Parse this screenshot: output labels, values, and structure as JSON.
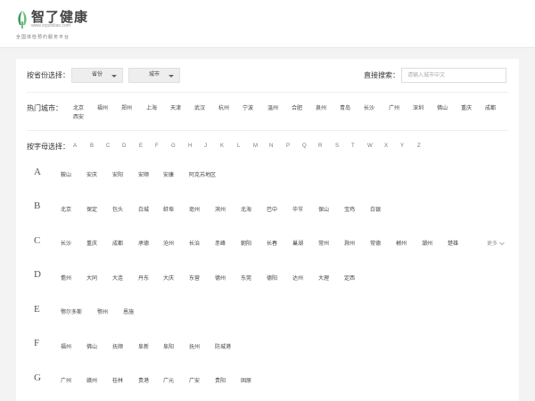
{
  "header": {
    "logo_name": "智了健康",
    "logo_url": "www.xrpzhiliao.com",
    "slogan": "全国体检预约服务平台"
  },
  "filters": {
    "province_label": "按省份选择：",
    "province_value": "省份",
    "city_value": "城市",
    "search_label": "直接搜索：",
    "search_placeholder": "请输入城市中文"
  },
  "hot": {
    "label": "热门城市：",
    "cities": [
      "北京",
      "福州",
      "郑州",
      "上海",
      "天津",
      "武汉",
      "杭州",
      "宁波",
      "温州",
      "合肥",
      "泉州",
      "青岛",
      "长沙",
      "广州",
      "深圳",
      "佛山",
      "重庆",
      "成都",
      "西安"
    ]
  },
  "letters": {
    "label": "按字母选择：",
    "items": [
      "A",
      "B",
      "C",
      "D",
      "E",
      "F",
      "G",
      "H",
      "J",
      "K",
      "L",
      "M",
      "N",
      "P",
      "Q",
      "R",
      "S",
      "T",
      "W",
      "X",
      "Y",
      "Z"
    ]
  },
  "groups": [
    {
      "letter": "A",
      "cities": [
        "鞍山",
        "安庆",
        "安阳",
        "安顺",
        "安康",
        "阿克苏地区"
      ]
    },
    {
      "letter": "B",
      "cities": [
        "北京",
        "保定",
        "包头",
        "白城",
        "蚌埠",
        "亳州",
        "滨州",
        "北海",
        "巴中",
        "毕节",
        "保山",
        "宝鸡",
        "白银"
      ]
    },
    {
      "letter": "C",
      "cities": [
        "长沙",
        "重庆",
        "成都",
        "承德",
        "沧州",
        "长治",
        "赤峰",
        "朝阳",
        "长春",
        "巢湖",
        "常州",
        "滁州",
        "常德",
        "郴州",
        "潮州",
        "楚雄"
      ],
      "more": "更多"
    },
    {
      "letter": "D",
      "cities": [
        "儋州",
        "大同",
        "大连",
        "丹东",
        "大庆",
        "东营",
        "德州",
        "东莞",
        "德阳",
        "达州",
        "大理",
        "定西"
      ]
    },
    {
      "letter": "E",
      "cities": [
        "鄂尔多斯",
        "鄂州",
        "恩施"
      ]
    },
    {
      "letter": "F",
      "cities": [
        "福州",
        "佛山",
        "抚顺",
        "阜新",
        "阜阳",
        "抚州",
        "防城港"
      ]
    },
    {
      "letter": "G",
      "cities": [
        "广州",
        "赣州",
        "桂林",
        "贵港",
        "广元",
        "广安",
        "贵阳",
        "固原"
      ]
    }
  ]
}
